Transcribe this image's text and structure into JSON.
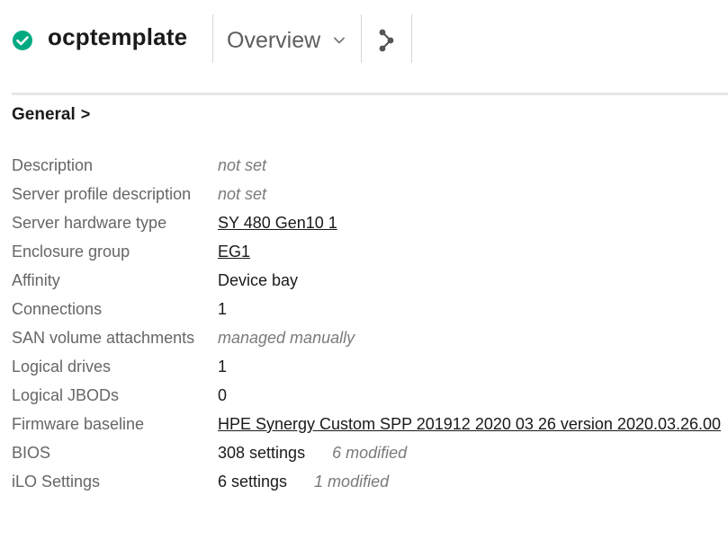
{
  "header": {
    "title": "ocptemplate",
    "status": "ok",
    "status_color": "#01a982",
    "view_label": "Overview",
    "chevron_icon": "chevron-down-icon",
    "share_icon": "share-icon"
  },
  "section": {
    "title": "General",
    "arrow": ">"
  },
  "rows": [
    {
      "label": "Description",
      "value": "not set",
      "style": "muted"
    },
    {
      "label": "Server profile description",
      "value": "not set",
      "style": "muted"
    },
    {
      "label": "Server hardware type",
      "value": "SY 480 Gen10 1",
      "style": "link"
    },
    {
      "label": "Enclosure group",
      "value": "EG1",
      "style": "link"
    },
    {
      "label": "Affinity",
      "value": "Device bay",
      "style": "plain"
    },
    {
      "label": "Connections",
      "value": "1",
      "style": "plain"
    },
    {
      "label": "SAN volume attachments",
      "value": "managed manually",
      "style": "muted"
    },
    {
      "label": "Logical drives",
      "value": "1",
      "style": "plain"
    },
    {
      "label": "Logical JBODs",
      "value": "0",
      "style": "plain"
    },
    {
      "label": "Firmware baseline",
      "value": "HPE Synergy Custom SPP 201912 2020 03 26 version 2020.03.26.00",
      "style": "link"
    },
    {
      "label": "BIOS",
      "value": "308 settings",
      "extra": "6 modified",
      "style": "plain"
    },
    {
      "label": "iLO Settings",
      "value": "6 settings",
      "extra": "1 modified",
      "style": "plain"
    }
  ]
}
